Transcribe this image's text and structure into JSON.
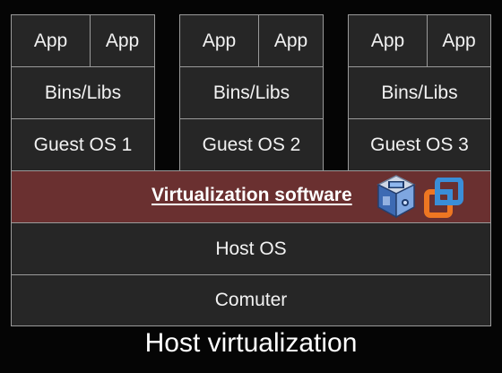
{
  "stacks": [
    {
      "apps": [
        "App",
        "App"
      ],
      "bins_libs": "Bins/Libs",
      "guest_os": "Guest OS 1"
    },
    {
      "apps": [
        "App",
        "App"
      ],
      "bins_libs": "Bins/Libs",
      "guest_os": "Guest OS 2"
    },
    {
      "apps": [
        "App",
        "App"
      ],
      "bins_libs": "Bins/Libs",
      "guest_os": "Guest OS 3"
    }
  ],
  "virtualization": {
    "label": "Virtualization software",
    "color": "#6a3030",
    "icons": [
      "virtualbox-icon",
      "vmware-icon"
    ]
  },
  "host_os": "Host OS",
  "computer": "Comuter",
  "caption": "Host virtualization",
  "colors": {
    "background": "#050505",
    "box": "#262626",
    "border": "#9a9a9a"
  }
}
